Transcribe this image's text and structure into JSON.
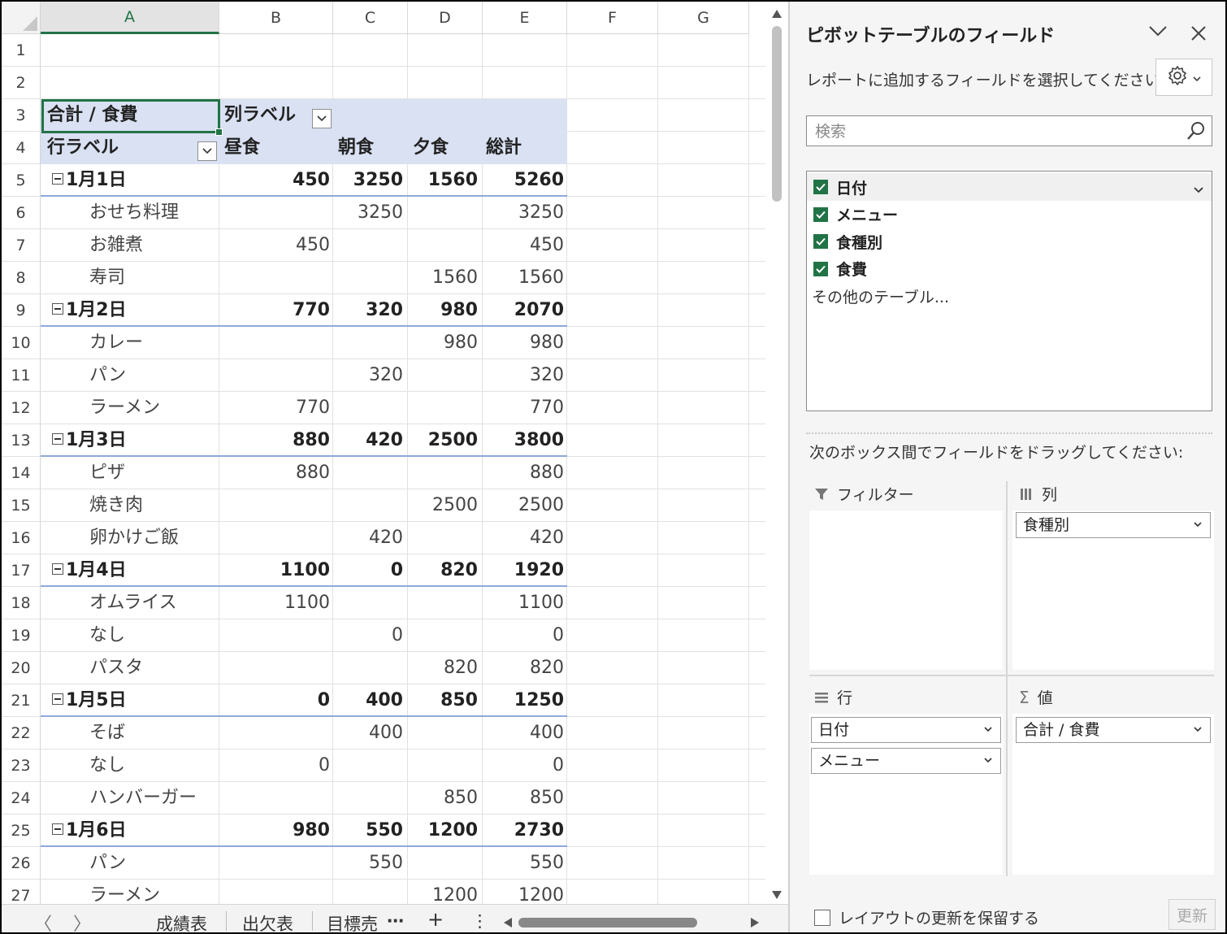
{
  "columns": [
    "A",
    "B",
    "C",
    "D",
    "E",
    "F",
    "G"
  ],
  "rows": [
    "1",
    "2",
    "3",
    "4",
    "5",
    "6",
    "7",
    "8",
    "9",
    "10",
    "11",
    "12",
    "13",
    "14",
    "15",
    "16",
    "17",
    "18",
    "19",
    "20",
    "21",
    "22",
    "23",
    "24",
    "25",
    "26",
    "27"
  ],
  "pivot": {
    "r3_value_label": "合計 / 食費",
    "r3_col_label": "列ラベル",
    "r4_row_label": "行ラベル",
    "headers": [
      "昼食",
      "朝食",
      "夕食",
      "総計"
    ],
    "lines": [
      {
        "row": 5,
        "group": true,
        "label": "1月1日",
        "vals": [
          "450",
          "3250",
          "1560",
          "5260"
        ]
      },
      {
        "row": 6,
        "group": false,
        "label": "おせち料理",
        "vals": [
          "",
          "3250",
          "",
          "3250"
        ]
      },
      {
        "row": 7,
        "group": false,
        "label": "お雑煮",
        "vals": [
          "450",
          "",
          "",
          "450"
        ]
      },
      {
        "row": 8,
        "group": false,
        "label": "寿司",
        "vals": [
          "",
          "",
          "1560",
          "1560"
        ]
      },
      {
        "row": 9,
        "group": true,
        "label": "1月2日",
        "vals": [
          "770",
          "320",
          "980",
          "2070"
        ]
      },
      {
        "row": 10,
        "group": false,
        "label": "カレー",
        "vals": [
          "",
          "",
          "980",
          "980"
        ]
      },
      {
        "row": 11,
        "group": false,
        "label": "パン",
        "vals": [
          "",
          "320",
          "",
          "320"
        ]
      },
      {
        "row": 12,
        "group": false,
        "label": "ラーメン",
        "vals": [
          "770",
          "",
          "",
          "770"
        ]
      },
      {
        "row": 13,
        "group": true,
        "label": "1月3日",
        "vals": [
          "880",
          "420",
          "2500",
          "3800"
        ]
      },
      {
        "row": 14,
        "group": false,
        "label": "ピザ",
        "vals": [
          "880",
          "",
          "",
          "880"
        ]
      },
      {
        "row": 15,
        "group": false,
        "label": "焼き肉",
        "vals": [
          "",
          "",
          "2500",
          "2500"
        ]
      },
      {
        "row": 16,
        "group": false,
        "label": "卵かけご飯",
        "vals": [
          "",
          "420",
          "",
          "420"
        ]
      },
      {
        "row": 17,
        "group": true,
        "label": "1月4日",
        "vals": [
          "1100",
          "0",
          "820",
          "1920"
        ]
      },
      {
        "row": 18,
        "group": false,
        "label": "オムライス",
        "vals": [
          "1100",
          "",
          "",
          "1100"
        ]
      },
      {
        "row": 19,
        "group": false,
        "label": "なし",
        "vals": [
          "",
          "0",
          "",
          "0"
        ]
      },
      {
        "row": 20,
        "group": false,
        "label": "パスタ",
        "vals": [
          "",
          "",
          "820",
          "820"
        ]
      },
      {
        "row": 21,
        "group": true,
        "label": "1月5日",
        "vals": [
          "0",
          "400",
          "850",
          "1250"
        ]
      },
      {
        "row": 22,
        "group": false,
        "label": "そば",
        "vals": [
          "",
          "400",
          "",
          "400"
        ]
      },
      {
        "row": 23,
        "group": false,
        "label": "なし",
        "vals": [
          "0",
          "",
          "",
          "0"
        ]
      },
      {
        "row": 24,
        "group": false,
        "label": "ハンバーガー",
        "vals": [
          "",
          "",
          "850",
          "850"
        ]
      },
      {
        "row": 25,
        "group": true,
        "label": "1月6日",
        "vals": [
          "980",
          "550",
          "1200",
          "2730"
        ]
      },
      {
        "row": 26,
        "group": false,
        "label": "パン",
        "vals": [
          "",
          "550",
          "",
          "550"
        ]
      },
      {
        "row": 27,
        "group": false,
        "label": "ラーメン",
        "vals": [
          "",
          "",
          "1200",
          "1200"
        ]
      }
    ]
  },
  "sheet_tabs": {
    "t1": "成績表",
    "t2": "出欠表",
    "t3": "目標売",
    "more": "⋯",
    "add": "+",
    "menu": "⋮",
    "prev": "〈",
    "next": "〉"
  },
  "pane": {
    "title": "ピボットテーブルのフィールド",
    "subtitle": "レポートに追加するフィールドを選択してください:",
    "search_placeholder": "検索",
    "fields": [
      "日付",
      "メニュー",
      "食種別",
      "食費"
    ],
    "more_tables": "その他のテーブル...",
    "drag_hint": "次のボックス間でフィールドをドラッグしてください:",
    "area_filter": "フィルター",
    "area_columns": "列",
    "area_rows": "行",
    "area_values": "値",
    "columns_chip": "食種別",
    "rows_chip1": "日付",
    "rows_chip2": "メニュー",
    "values_chip": "合計 / 食費",
    "defer_label": "レイアウトの更新を保留する",
    "update_btn": "更新"
  },
  "colors": {
    "accent": "#217346",
    "pivot_band": "#d9e1f2",
    "group_line": "#8ea9db"
  }
}
